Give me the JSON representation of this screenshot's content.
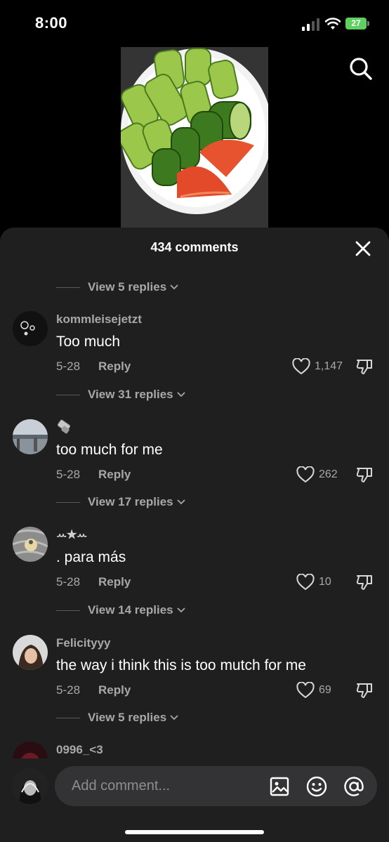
{
  "status_bar": {
    "time": "8:00",
    "battery": "27"
  },
  "header": {
    "search_icon": "search-icon"
  },
  "sheet": {
    "title": "434 comments",
    "close_icon": "close-icon"
  },
  "thread": [
    {
      "replies_label": "View 5 replies"
    },
    {
      "user": "kommleisejetzt",
      "text": "Too much",
      "date": "5-28",
      "reply": "Reply",
      "likes": "1,147",
      "replies_label": "View 31 replies"
    },
    {
      "user": "",
      "text": "too much for me",
      "date": "5-28",
      "reply": "Reply",
      "likes": "262",
      "replies_label": "View 17 replies"
    },
    {
      "user": "ꕀ★ꕀ",
      "text": ". para más",
      "date": "5-28",
      "reply": "Reply",
      "likes": "10",
      "replies_label": "View 14 replies"
    },
    {
      "user": "Felicityyy",
      "text": "the way i think this is too mutch for me",
      "date": "5-28",
      "reply": "Reply",
      "likes": "69",
      "replies_label": "View 5 replies"
    },
    {
      "user": "0996_<3"
    }
  ],
  "composer": {
    "placeholder": "Add comment...",
    "icons": [
      "image-icon",
      "emoji-icon",
      "mention-icon"
    ]
  },
  "colors": {
    "sheet_bg": "#1f1f1f",
    "secondary_text": "#a8a8a8",
    "battery": "#5ed05f"
  }
}
